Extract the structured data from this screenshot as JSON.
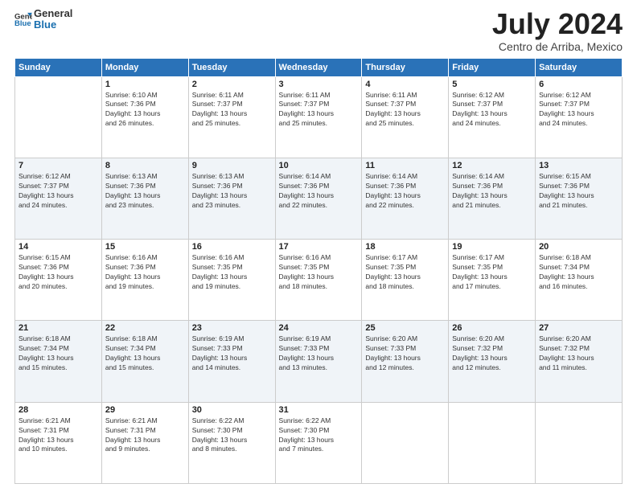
{
  "logo": {
    "line1": "General",
    "line2": "Blue"
  },
  "title": "July 2024",
  "location": "Centro de Arriba, Mexico",
  "header": {
    "days": [
      "Sunday",
      "Monday",
      "Tuesday",
      "Wednesday",
      "Thursday",
      "Friday",
      "Saturday"
    ]
  },
  "weeks": [
    [
      {
        "day": "",
        "info": ""
      },
      {
        "day": "1",
        "info": "Sunrise: 6:10 AM\nSunset: 7:36 PM\nDaylight: 13 hours\nand 26 minutes."
      },
      {
        "day": "2",
        "info": "Sunrise: 6:11 AM\nSunset: 7:37 PM\nDaylight: 13 hours\nand 25 minutes."
      },
      {
        "day": "3",
        "info": "Sunrise: 6:11 AM\nSunset: 7:37 PM\nDaylight: 13 hours\nand 25 minutes."
      },
      {
        "day": "4",
        "info": "Sunrise: 6:11 AM\nSunset: 7:37 PM\nDaylight: 13 hours\nand 25 minutes."
      },
      {
        "day": "5",
        "info": "Sunrise: 6:12 AM\nSunset: 7:37 PM\nDaylight: 13 hours\nand 24 minutes."
      },
      {
        "day": "6",
        "info": "Sunrise: 6:12 AM\nSunset: 7:37 PM\nDaylight: 13 hours\nand 24 minutes."
      }
    ],
    [
      {
        "day": "7",
        "info": "Sunrise: 6:12 AM\nSunset: 7:37 PM\nDaylight: 13 hours\nand 24 minutes."
      },
      {
        "day": "8",
        "info": "Sunrise: 6:13 AM\nSunset: 7:36 PM\nDaylight: 13 hours\nand 23 minutes."
      },
      {
        "day": "9",
        "info": "Sunrise: 6:13 AM\nSunset: 7:36 PM\nDaylight: 13 hours\nand 23 minutes."
      },
      {
        "day": "10",
        "info": "Sunrise: 6:14 AM\nSunset: 7:36 PM\nDaylight: 13 hours\nand 22 minutes."
      },
      {
        "day": "11",
        "info": "Sunrise: 6:14 AM\nSunset: 7:36 PM\nDaylight: 13 hours\nand 22 minutes."
      },
      {
        "day": "12",
        "info": "Sunrise: 6:14 AM\nSunset: 7:36 PM\nDaylight: 13 hours\nand 21 minutes."
      },
      {
        "day": "13",
        "info": "Sunrise: 6:15 AM\nSunset: 7:36 PM\nDaylight: 13 hours\nand 21 minutes."
      }
    ],
    [
      {
        "day": "14",
        "info": "Sunrise: 6:15 AM\nSunset: 7:36 PM\nDaylight: 13 hours\nand 20 minutes."
      },
      {
        "day": "15",
        "info": "Sunrise: 6:16 AM\nSunset: 7:36 PM\nDaylight: 13 hours\nand 19 minutes."
      },
      {
        "day": "16",
        "info": "Sunrise: 6:16 AM\nSunset: 7:35 PM\nDaylight: 13 hours\nand 19 minutes."
      },
      {
        "day": "17",
        "info": "Sunrise: 6:16 AM\nSunset: 7:35 PM\nDaylight: 13 hours\nand 18 minutes."
      },
      {
        "day": "18",
        "info": "Sunrise: 6:17 AM\nSunset: 7:35 PM\nDaylight: 13 hours\nand 18 minutes."
      },
      {
        "day": "19",
        "info": "Sunrise: 6:17 AM\nSunset: 7:35 PM\nDaylight: 13 hours\nand 17 minutes."
      },
      {
        "day": "20",
        "info": "Sunrise: 6:18 AM\nSunset: 7:34 PM\nDaylight: 13 hours\nand 16 minutes."
      }
    ],
    [
      {
        "day": "21",
        "info": "Sunrise: 6:18 AM\nSunset: 7:34 PM\nDaylight: 13 hours\nand 15 minutes."
      },
      {
        "day": "22",
        "info": "Sunrise: 6:18 AM\nSunset: 7:34 PM\nDaylight: 13 hours\nand 15 minutes."
      },
      {
        "day": "23",
        "info": "Sunrise: 6:19 AM\nSunset: 7:33 PM\nDaylight: 13 hours\nand 14 minutes."
      },
      {
        "day": "24",
        "info": "Sunrise: 6:19 AM\nSunset: 7:33 PM\nDaylight: 13 hours\nand 13 minutes."
      },
      {
        "day": "25",
        "info": "Sunrise: 6:20 AM\nSunset: 7:33 PM\nDaylight: 13 hours\nand 12 minutes."
      },
      {
        "day": "26",
        "info": "Sunrise: 6:20 AM\nSunset: 7:32 PM\nDaylight: 13 hours\nand 12 minutes."
      },
      {
        "day": "27",
        "info": "Sunrise: 6:20 AM\nSunset: 7:32 PM\nDaylight: 13 hours\nand 11 minutes."
      }
    ],
    [
      {
        "day": "28",
        "info": "Sunrise: 6:21 AM\nSunset: 7:31 PM\nDaylight: 13 hours\nand 10 minutes."
      },
      {
        "day": "29",
        "info": "Sunrise: 6:21 AM\nSunset: 7:31 PM\nDaylight: 13 hours\nand 9 minutes."
      },
      {
        "day": "30",
        "info": "Sunrise: 6:22 AM\nSunset: 7:30 PM\nDaylight: 13 hours\nand 8 minutes."
      },
      {
        "day": "31",
        "info": "Sunrise: 6:22 AM\nSunset: 7:30 PM\nDaylight: 13 hours\nand 7 minutes."
      },
      {
        "day": "",
        "info": ""
      },
      {
        "day": "",
        "info": ""
      },
      {
        "day": "",
        "info": ""
      }
    ]
  ]
}
